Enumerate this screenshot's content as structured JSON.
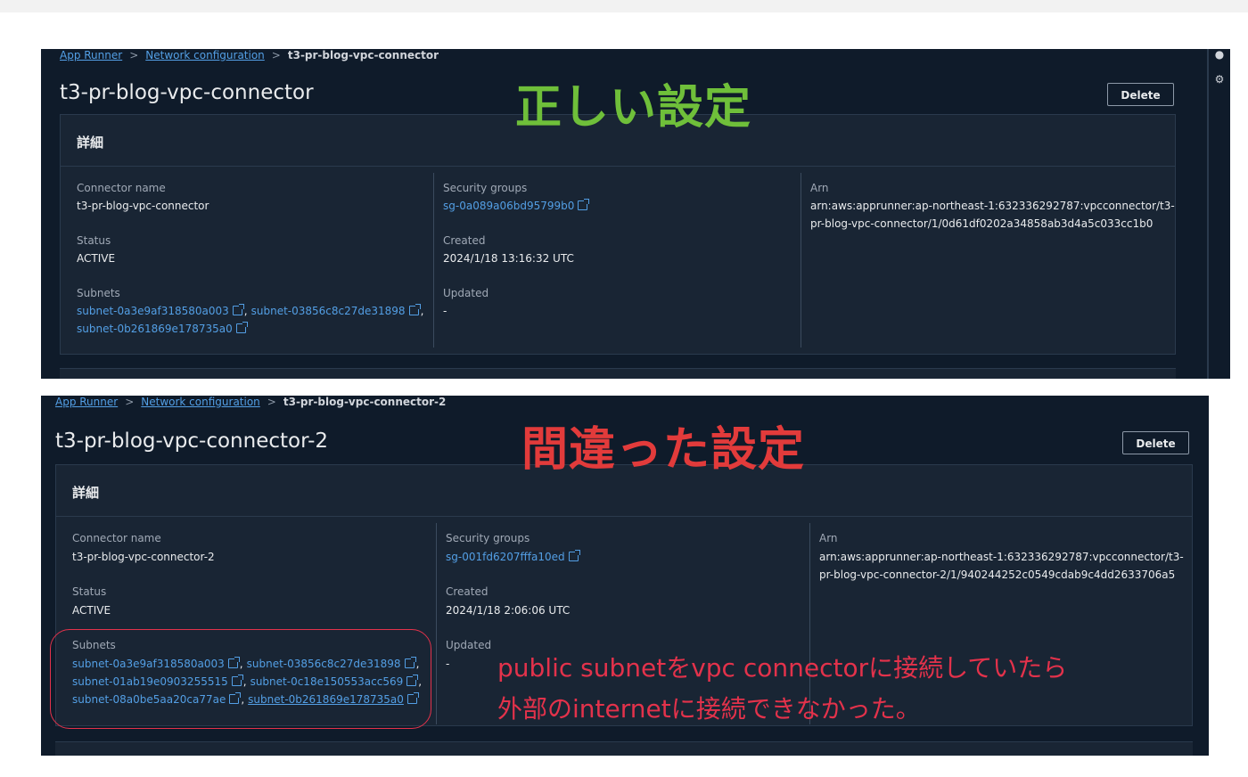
{
  "panels": [
    {
      "breadcrumb": [
        "App Runner",
        "Network configuration",
        "t3-pr-blog-vpc-connector"
      ],
      "title": "t3-pr-blog-vpc-connector",
      "delete_label": "Delete",
      "card_title": "詳細",
      "connector_name_label": "Connector name",
      "connector_name": "t3-pr-blog-vpc-connector",
      "status_label": "Status",
      "status": "ACTIVE",
      "subnets_label": "Subnets",
      "subnets": [
        "subnet-0a3e9af318580a003",
        "subnet-03856c8c27de31898",
        "subnet-0b261869e178735a0"
      ],
      "security_groups_label": "Security groups",
      "security_group": "sg-0a089a06bd95799b0",
      "created_label": "Created",
      "created": "2024/1/18 13:16:32 UTC",
      "updated_label": "Updated",
      "updated": "-",
      "arn_label": "Arn",
      "arn_line1": "arn:aws:apprunner:ap-northeast-1:632336292787:vpcconnector/t3-",
      "arn_line2": "pr-blog-vpc-connector/1/0d61df0202a34858ab3d4a5c033cc1b0"
    },
    {
      "breadcrumb": [
        "App Runner",
        "Network configuration",
        "t3-pr-blog-vpc-connector-2"
      ],
      "title": "t3-pr-blog-vpc-connector-2",
      "delete_label": "Delete",
      "card_title": "詳細",
      "connector_name_label": "Connector name",
      "connector_name": "t3-pr-blog-vpc-connector-2",
      "status_label": "Status",
      "status": "ACTIVE",
      "subnets_label": "Subnets",
      "subnets": [
        "subnet-0a3e9af318580a003",
        "subnet-03856c8c27de31898",
        "subnet-01ab19e0903255515",
        "subnet-0c18e150553acc569",
        "subnet-08a0be5aa20ca77ae",
        "subnet-0b261869e178735a0"
      ],
      "security_groups_label": "Security groups",
      "security_group": "sg-001fd6207fffa10ed",
      "created_label": "Created",
      "created": "2024/1/18 2:06:06 UTC",
      "updated_label": "Updated",
      "updated": "-",
      "arn_label": "Arn",
      "arn_line1": "arn:aws:apprunner:ap-northeast-1:632336292787:vpcconnector/t3-",
      "arn_line2": "pr-blog-vpc-connector-2/1/940244252c0549cdab9c4dd2633706a5"
    }
  ],
  "annotations": {
    "correct": "正しい設定",
    "wrong": "間違った設定",
    "note_line1": "public subnetをvpc connectorに接続していたら",
    "note_line2": "外部のinternetに接続できなかった。"
  },
  "colors": {
    "correct": "#6fbf3a",
    "wrong": "#e23b3b",
    "link": "#539fe5",
    "background": "#0f1b2a"
  },
  "icons": [
    "chevron-right-icon",
    "external-link-icon",
    "settings-icon"
  ]
}
